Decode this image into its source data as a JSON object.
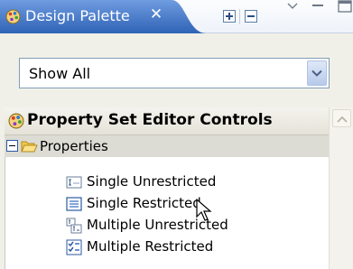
{
  "tab": {
    "title": "Design Palette",
    "close_glyph": "✕",
    "icon": "palette-icon"
  },
  "toolbar": {
    "expand_icon": "expand-all-icon",
    "collapse_icon": "collapse-all-icon",
    "menu_icon": "view-menu-icon",
    "minimize_icon": "minimize-icon"
  },
  "filter": {
    "selected": "Show All"
  },
  "drawer": {
    "title": "Property Set Editor Controls",
    "icon": "palette-icon"
  },
  "category": {
    "label": "Properties",
    "icon": "folder-open-icon"
  },
  "items": [
    {
      "label": "Single Unrestricted",
      "icon": "text-field-icon"
    },
    {
      "label": "Single Restricted",
      "icon": "list-box-icon"
    },
    {
      "label": "Multiple Unrestricted",
      "icon": "multi-text-icon"
    },
    {
      "label": "Multiple Restricted",
      "icon": "checklist-icon"
    }
  ],
  "colors": {
    "tab_active": "#3a6fc1",
    "accent": "#2c5aa0",
    "panel": "#f1f0e8"
  }
}
